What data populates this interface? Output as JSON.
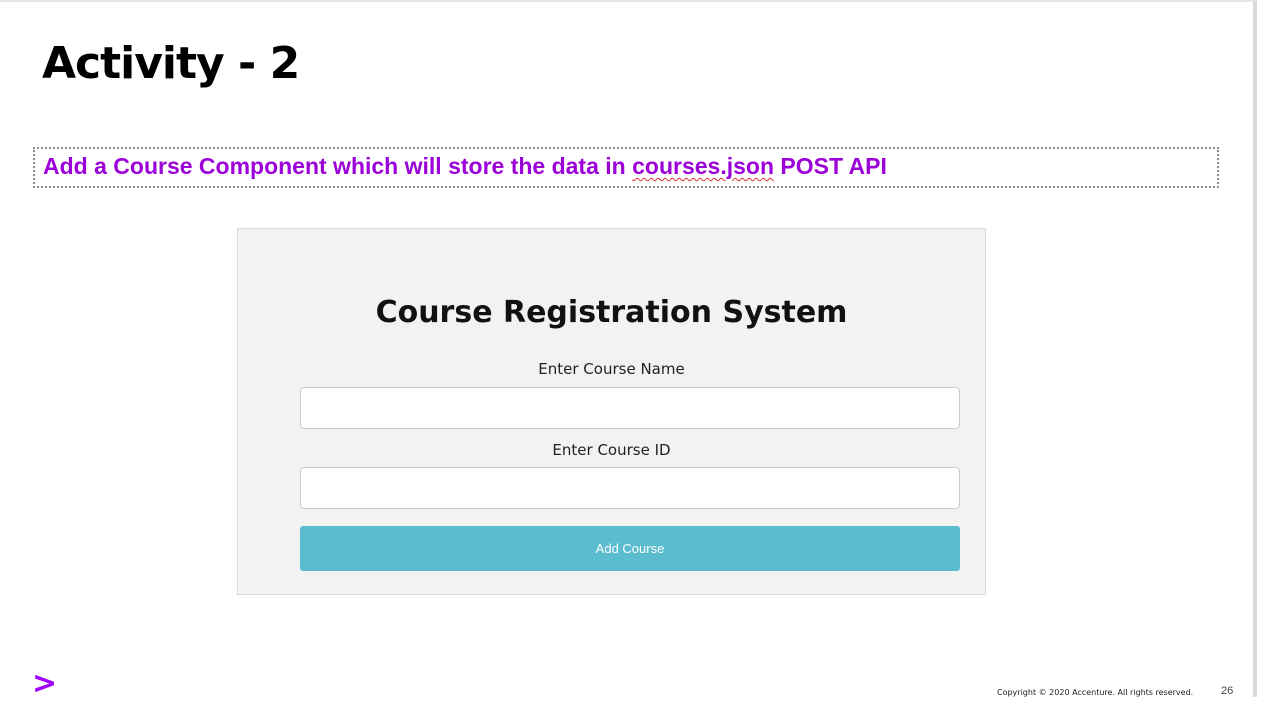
{
  "slide": {
    "title": "Activity - 2",
    "instruction": {
      "before": "Add a Course Component which will store the data in ",
      "highlight": "courses.json",
      "after": " POST  API"
    }
  },
  "form": {
    "heading": "Course Registration System",
    "course_name_label": "Enter Course Name",
    "course_name_value": "",
    "course_id_label": "Enter Course ID",
    "course_id_value": "",
    "submit_label": "Add Course",
    "submit_color": "#5bbcd0"
  },
  "footer": {
    "logo": ">",
    "logo_color": "#a100ff",
    "copyright": "Copyright © 2020 Accenture. All rights reserved.",
    "page_number": "26"
  },
  "colors": {
    "instruction_text": "#9b00d9"
  }
}
